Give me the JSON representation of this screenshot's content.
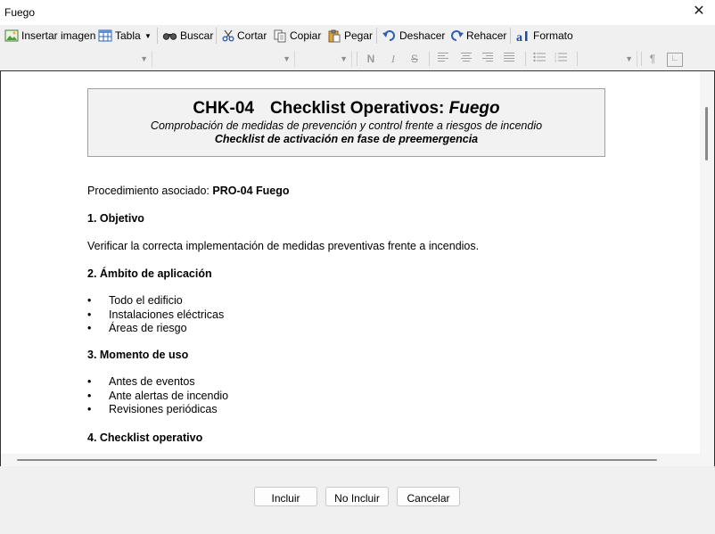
{
  "window": {
    "title": "Fuego"
  },
  "toolbar": {
    "insert_image": "Insertar imagen",
    "table": "Tabla",
    "search": "Buscar",
    "cut": "Cortar",
    "copy": "Copiar",
    "paste": "Pegar",
    "undo": "Deshacer",
    "redo": "Rehacer",
    "format": "Formato"
  },
  "formatbar": {
    "bold": "N",
    "italic": "I",
    "strike": "S",
    "paragraph": "¶"
  },
  "document": {
    "header": {
      "code": "CHK-04",
      "title_main": "Checklist Operativos:",
      "title_em": "Fuego",
      "subtitle": "Comprobación de medidas de prevención y control frente a riesgos de incendio",
      "subtitle2": "Checklist de activación en fase de preemergencia"
    },
    "procedure_label": "Procedimiento asociado:",
    "procedure_value": "PRO-04 Fuego",
    "s1_heading": "1. Objetivo",
    "s1_text": "Verificar la correcta implementación de medidas preventivas frente a incendios.",
    "s2_heading": "2. Ámbito de aplicación",
    "s2_items": [
      "Todo el edificio",
      "Instalaciones eléctricas",
      "Áreas de riesgo"
    ],
    "s3_heading": "3. Momento de uso",
    "s3_items": [
      "Antes de eventos",
      "Ante alertas de incendio",
      "Revisiones periódicas"
    ],
    "s4_heading": "4. Checklist operativo"
  },
  "buttons": {
    "include": "Incluir",
    "not_include": "No Incluir",
    "cancel": "Cancelar"
  }
}
